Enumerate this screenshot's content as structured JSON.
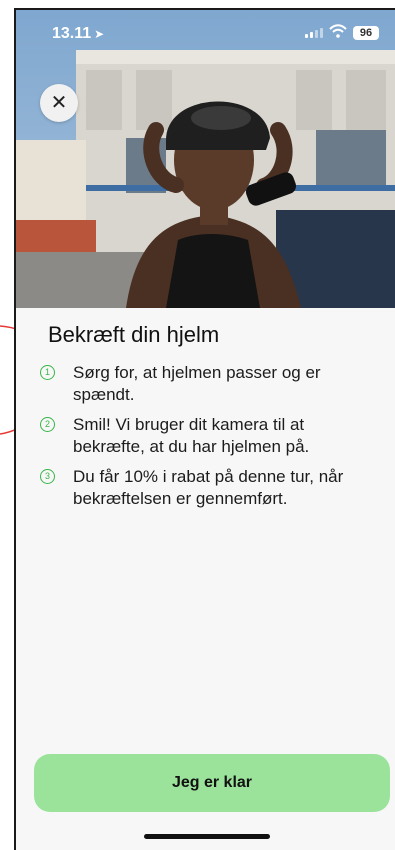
{
  "status_bar": {
    "time": "13.11",
    "battery": "96"
  },
  "title": "Bekræft din hjelm",
  "steps": [
    {
      "number": "1",
      "text": "Sørg for, at hjelmen passer og er spændt."
    },
    {
      "number": "2",
      "text": "Smil! Vi bruger dit kamera til at bekræfte, at du har hjelmen på."
    },
    {
      "number": "3",
      "text": "Du får 10% i rabat på denne tur, når bekræftelsen er gennemført."
    }
  ],
  "cta_label": "Jeg er klar",
  "colors": {
    "accent": "#39b54a",
    "button_bg": "#9be39a",
    "annotation": "#e53935"
  },
  "icons": [
    "close-icon",
    "location-arrow-icon",
    "signal-icon",
    "wifi-icon",
    "battery-icon"
  ]
}
